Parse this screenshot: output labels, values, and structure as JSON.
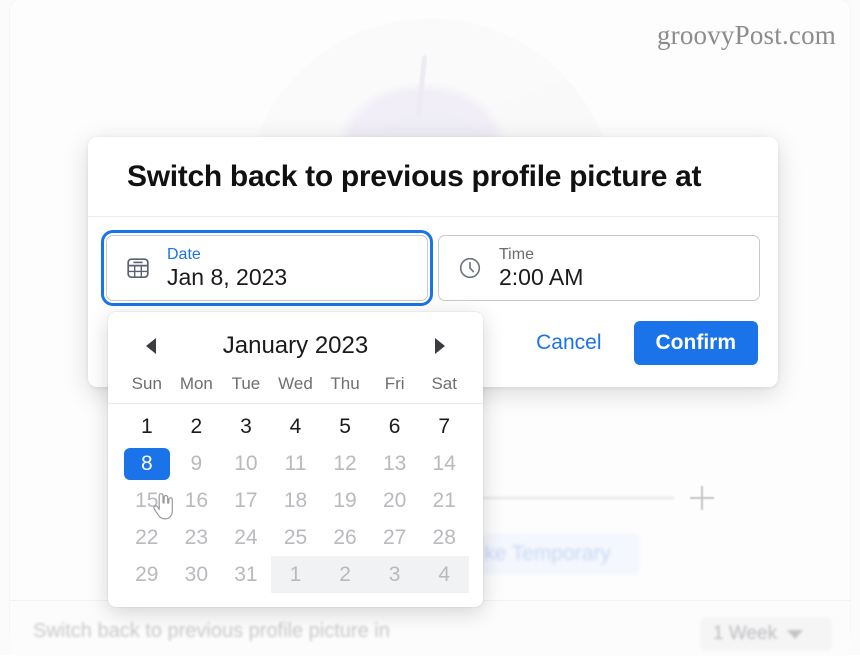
{
  "background": {
    "watermark": "groovyPost.com",
    "avatar_alt": "football-player-profile-picture",
    "make_temporary_label": "ke Temporary",
    "bottom_label": "Switch back to previous profile picture in",
    "week_dropdown_value": "1 Week",
    "plus_icon": "plus-icon",
    "caret_icon": "chevron-down-icon"
  },
  "dialog": {
    "title": "Switch back to previous profile picture at",
    "date_field": {
      "label": "Date",
      "value": "Jan 8, 2023",
      "icon": "calendar-icon",
      "focused": true
    },
    "time_field": {
      "label": "Time",
      "value": "2:00 AM",
      "icon": "clock-icon",
      "focused": false
    },
    "cancel_label": "Cancel",
    "confirm_label": "Confirm"
  },
  "calendar": {
    "month_label": "January 2023",
    "prev_icon": "chevron-left-icon",
    "next_icon": "chevron-right-icon",
    "weekdays": [
      "Sun",
      "Mon",
      "Tue",
      "Wed",
      "Thu",
      "Fri",
      "Sat"
    ],
    "selected_day": 8,
    "cells": [
      {
        "d": "1",
        "state": "normal"
      },
      {
        "d": "2",
        "state": "normal"
      },
      {
        "d": "3",
        "state": "normal"
      },
      {
        "d": "4",
        "state": "normal"
      },
      {
        "d": "5",
        "state": "normal"
      },
      {
        "d": "6",
        "state": "normal"
      },
      {
        "d": "7",
        "state": "normal"
      },
      {
        "d": "8",
        "state": "selected"
      },
      {
        "d": "9",
        "state": "dim"
      },
      {
        "d": "10",
        "state": "dim"
      },
      {
        "d": "11",
        "state": "dim"
      },
      {
        "d": "12",
        "state": "dim"
      },
      {
        "d": "13",
        "state": "dim"
      },
      {
        "d": "14",
        "state": "dim"
      },
      {
        "d": "15",
        "state": "dim"
      },
      {
        "d": "16",
        "state": "dim"
      },
      {
        "d": "17",
        "state": "dim"
      },
      {
        "d": "18",
        "state": "dim"
      },
      {
        "d": "19",
        "state": "dim"
      },
      {
        "d": "20",
        "state": "dim"
      },
      {
        "d": "21",
        "state": "dim"
      },
      {
        "d": "22",
        "state": "dim"
      },
      {
        "d": "23",
        "state": "dim"
      },
      {
        "d": "24",
        "state": "dim"
      },
      {
        "d": "25",
        "state": "dim"
      },
      {
        "d": "26",
        "state": "dim"
      },
      {
        "d": "27",
        "state": "dim"
      },
      {
        "d": "28",
        "state": "dim"
      },
      {
        "d": "29",
        "state": "dim"
      },
      {
        "d": "30",
        "state": "dim"
      },
      {
        "d": "31",
        "state": "dim"
      },
      {
        "d": "1",
        "state": "othermonth"
      },
      {
        "d": "2",
        "state": "othermonth"
      },
      {
        "d": "3",
        "state": "othermonth"
      },
      {
        "d": "4",
        "state": "othermonth"
      }
    ]
  },
  "colors": {
    "accent_blue": "#1a73e8",
    "selected_day_bg": "#1a73e8",
    "dim_text": "#b9b9be",
    "text": "#1b1b1d"
  },
  "cursor": {
    "icon": "pointing-hand-cursor"
  }
}
